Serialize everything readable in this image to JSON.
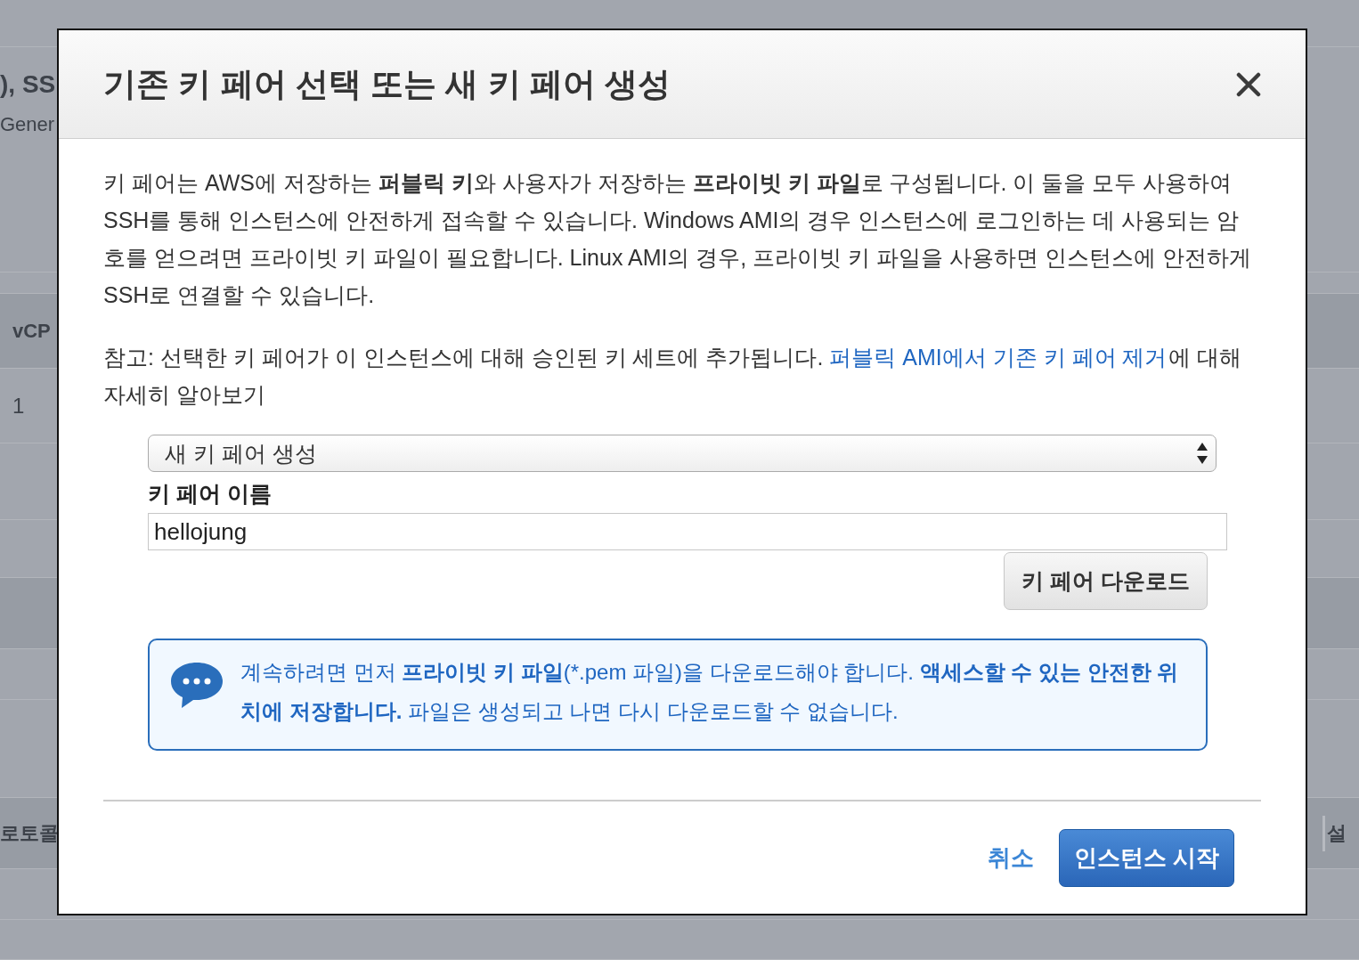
{
  "background_page": {
    "heading_fragment": "), SS",
    "subtitle_fragment": "Gener",
    "column_header_fragment": "vCP",
    "cell_fragment": "1",
    "table_header_fragments": [
      "로토콜",
      "설"
    ]
  },
  "dialog": {
    "title": "기존 키 페어 선택 또는 새 키 페어 생성",
    "description": "키 페어는 AWS에 저장하는 **퍼블릭 키**와 사용자가 저장하는 **프라이빗 키 파일**로 구성됩니다. 이 둘을 모두 사용하여 SSH를 통해 인스턴스에 안전하게 접속할 수 있습니다. Windows AMI의 경우 인스턴스에 로그인하는 데 사용되는 암호를 얻으려면 프라이빗 키 파일이 필요합니다. Linux AMI의 경우, 프라이빗 키 파일을 사용하면 인스턴스에 안전하게 SSH로 연결할 수 있습니다.",
    "note": {
      "before": "참고: 선택한 키 페어가 이 인스턴스에 대해 승인된 키 세트에 추가됩니다.",
      "link": "퍼블릭 AMI에서 기존 키 페어 제거",
      "after": "에 대해 자세히 알아보기"
    },
    "select": {
      "value": "새 키 페어 생성"
    },
    "key_pair_name": {
      "label": "키 페어 이름",
      "value": "hellojung"
    },
    "download_button": "키 페어 다운로드",
    "notice": "계속하려면 먼저 **프라이빗 키 파일**(*.pem 파일)을 다운로드해야 합니다. **액세스할 수 있는 안전한 위치에 저장합니다.** 파일은 생성되고 나면 다시 다운로드할 수 없습니다.",
    "buttons": [
      {
        "kind": "link",
        "label": "취소"
      },
      {
        "kind": "primary",
        "label": "인스턴스 시작"
      }
    ]
  }
}
